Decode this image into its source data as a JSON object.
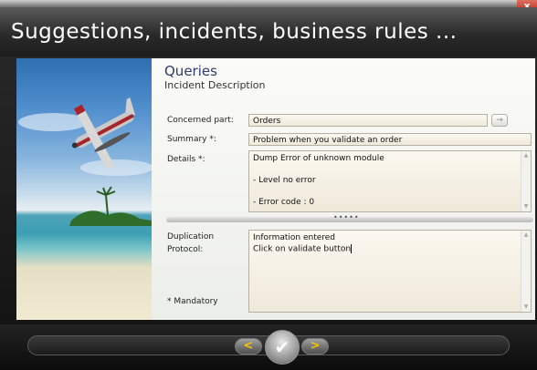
{
  "window": {
    "title": "Suggestions, incidents, business rules ...",
    "close_label": "x"
  },
  "section": {
    "title": "Queries",
    "subtitle": "Incident Description"
  },
  "form": {
    "concerned_part": {
      "label": "Concerned part:",
      "value": "Orders",
      "button_icon": "→"
    },
    "summary": {
      "label": "Summary *:",
      "value": "Problem when you validate an order"
    },
    "details": {
      "label": "Details *:",
      "lines": [
        "Dump Error of unknown module",
        "- Level no error",
        "- Error code : 0"
      ]
    },
    "splitter_grip": "•••••",
    "duplication": {
      "label_line1": "Duplication",
      "label_line2": "Protocol:",
      "lines": [
        "Information entered",
        "Click on validate button"
      ]
    },
    "mandatory_note": "* Mandatory"
  },
  "nav": {
    "prev_icon": "<",
    "validate_icon": "✔",
    "next_icon": ">"
  },
  "colors": {
    "accent_title": "#2e3b6b",
    "nav_arrow": "#f5c400",
    "close_button": "#c0392b"
  }
}
